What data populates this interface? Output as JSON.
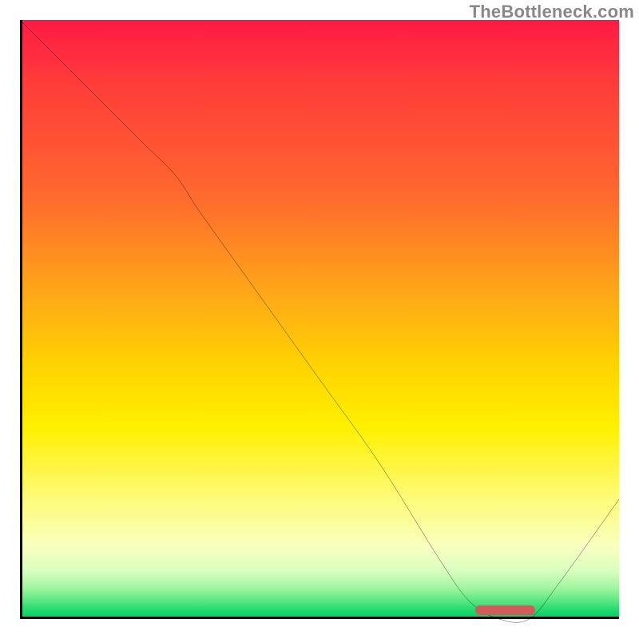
{
  "watermark": "TheBottleneck.com",
  "chart_data": {
    "type": "line",
    "title": "",
    "xlabel": "",
    "ylabel": "",
    "xlim": [
      0,
      100
    ],
    "ylim": [
      0,
      100
    ],
    "grid": false,
    "legend": false,
    "background": {
      "kind": "vertical-gradient",
      "stops": [
        {
          "pos": 0,
          "color": "#ff1a44"
        },
        {
          "pos": 30,
          "color": "#ff6b2d"
        },
        {
          "pos": 58,
          "color": "#ffd400"
        },
        {
          "pos": 88,
          "color": "#f9ffc0"
        },
        {
          "pos": 100,
          "color": "#0cc765"
        }
      ]
    },
    "series": [
      {
        "name": "bottleneck-curve",
        "color": "#000000",
        "x": [
          0,
          10,
          20,
          26,
          30,
          40,
          50,
          60,
          70,
          75,
          80,
          85,
          90,
          100
        ],
        "y": [
          100,
          90,
          80,
          74,
          68,
          54,
          40,
          26,
          10,
          3,
          0,
          0,
          6,
          20
        ]
      }
    ],
    "annotations": [
      {
        "name": "optimal-range-marker",
        "kind": "bar-marker",
        "x_start": 76,
        "x_end": 86,
        "y": 0.8,
        "color": "#cf5b5b"
      }
    ]
  }
}
